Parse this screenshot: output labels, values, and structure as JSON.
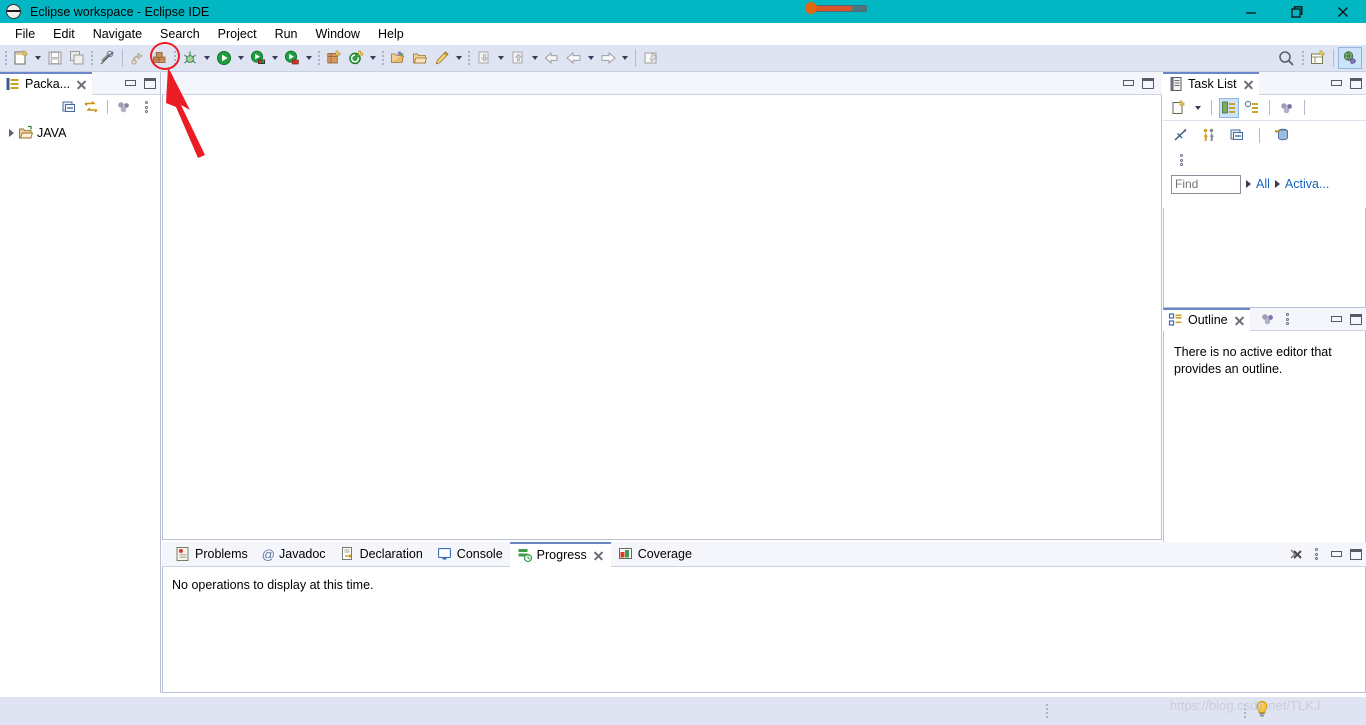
{
  "window": {
    "title": "Eclipse workspace - Eclipse IDE",
    "icon": "eclipse-globe-icon",
    "titlebar_color": "#00b7c3",
    "controls": {
      "minimize": "minimize-button",
      "restore": "restore-button",
      "close": "close-button"
    }
  },
  "menubar": {
    "items": [
      {
        "label": "File"
      },
      {
        "label": "Edit"
      },
      {
        "label": "Navigate"
      },
      {
        "label": "Search"
      },
      {
        "label": "Project"
      },
      {
        "label": "Run"
      },
      {
        "label": "Window"
      },
      {
        "label": "Help"
      }
    ]
  },
  "toolbar": {
    "background": "#dfe4f3",
    "groups": [
      {
        "buttons": [
          {
            "name": "new-wizard-icon",
            "tooltip": "New",
            "dropdown": true,
            "enabled": true
          },
          {
            "name": "save-icon",
            "tooltip": "Save",
            "enabled": false
          },
          {
            "name": "save-all-icon",
            "tooltip": "Save All",
            "enabled": false
          }
        ]
      },
      {
        "buttons": [
          {
            "name": "toggle-mark-occurrences-icon",
            "tooltip": "Toggle Mark Occurrences",
            "enabled": false
          }
        ]
      },
      {
        "buttons": [
          {
            "name": "build-all-icon",
            "tooltip": "Build All",
            "enabled": false
          },
          {
            "name": "new-java-package-icon",
            "tooltip": "New Java Package",
            "enabled": true,
            "highlighted": true
          }
        ]
      },
      {
        "buttons": [
          {
            "name": "debug-icon",
            "tooltip": "Debug",
            "dropdown": true,
            "enabled": true
          },
          {
            "name": "run-icon",
            "tooltip": "Run",
            "dropdown": true,
            "enabled": true
          },
          {
            "name": "coverage-icon",
            "tooltip": "Coverage",
            "dropdown": true,
            "enabled": true
          },
          {
            "name": "run-external-tools-icon",
            "tooltip": "External Tools",
            "dropdown": true,
            "enabled": true
          }
        ]
      },
      {
        "buttons": [
          {
            "name": "new-java-project-icon",
            "tooltip": "New Java Project",
            "enabled": true
          },
          {
            "name": "new-java-class-icon",
            "tooltip": "New Java Class",
            "dropdown": true,
            "enabled": true
          }
        ]
      },
      {
        "buttons": [
          {
            "name": "open-type-icon",
            "tooltip": "Open Type",
            "enabled": true
          },
          {
            "name": "open-task-icon",
            "tooltip": "Open Task",
            "enabled": true
          },
          {
            "name": "edit-icon",
            "tooltip": "Edit",
            "dropdown": true,
            "enabled": true
          }
        ]
      },
      {
        "buttons": [
          {
            "name": "next-annotation-icon",
            "tooltip": "Next Annotation",
            "dropdown": true,
            "enabled": false
          },
          {
            "name": "previous-annotation-icon",
            "tooltip": "Previous Annotation",
            "dropdown": true,
            "enabled": false
          },
          {
            "name": "last-edit-location-icon",
            "tooltip": "Last Edit Location",
            "enabled": false
          },
          {
            "name": "back-icon",
            "tooltip": "Back",
            "dropdown": true,
            "enabled": false
          },
          {
            "name": "forward-icon",
            "tooltip": "Forward",
            "dropdown": true,
            "enabled": false
          }
        ]
      },
      {
        "buttons": [
          {
            "name": "pin-editor-icon",
            "tooltip": "Pin Editor",
            "enabled": false
          }
        ]
      }
    ],
    "right_buttons": [
      {
        "name": "search-icon",
        "tooltip": "Search"
      },
      {
        "name": "open-perspective-icon",
        "tooltip": "Open Perspective"
      },
      {
        "name": "java-ee-perspective-icon",
        "tooltip": "Java EE",
        "active": true
      }
    ]
  },
  "annotation": {
    "ellipse_target": "new-java-package-icon",
    "arrow": "red-arrow-pointer",
    "color": "#ec1c24"
  },
  "package_explorer": {
    "tab_label": "Packa...",
    "tab_icon": "package-explorer-icon",
    "toolbar": [
      {
        "name": "collapse-all-icon",
        "tooltip": "Collapse All"
      },
      {
        "name": "link-with-editor-icon",
        "tooltip": "Link with Editor"
      },
      {
        "name": "view-menu-icon",
        "tooltip": "View Menu"
      },
      {
        "name": "panel-menu-icon",
        "tooltip": "Menu"
      }
    ],
    "tree": [
      {
        "label": "JAVA",
        "icon": "java-project-folder-icon",
        "expanded": false
      }
    ]
  },
  "editor": {
    "empty": true,
    "buttons": [
      {
        "name": "minimize-editor-button"
      },
      {
        "name": "maximize-editor-button"
      }
    ]
  },
  "task_list": {
    "tab_label": "Task List",
    "tab_icon": "task-list-icon",
    "toolbar_row1": [
      {
        "name": "new-task-icon",
        "tooltip": "New Task",
        "dropdown": true
      },
      {
        "name": "categorized-presentation-icon",
        "tooltip": "Categorized",
        "active": true
      },
      {
        "name": "scheduled-presentation-icon",
        "tooltip": "Scheduled"
      },
      {
        "name": "view-menu-icon",
        "tooltip": "View Menu"
      }
    ],
    "toolbar_row2": [
      {
        "name": "focus-on-workweek-icon",
        "tooltip": "Focus on Workweek"
      },
      {
        "name": "synchronize-changed-icon",
        "tooltip": "Synchronize Changed"
      },
      {
        "name": "collapse-all-icon",
        "tooltip": "Collapse All"
      },
      {
        "name": "open-repository-task-icon",
        "tooltip": "Open Repository Task"
      }
    ],
    "toolbar_row3": [
      {
        "name": "panel-menu-icon",
        "tooltip": "Menu"
      }
    ],
    "find": {
      "placeholder": "Find",
      "value": ""
    },
    "filters": [
      {
        "label": "All"
      },
      {
        "label": "Activa..."
      }
    ]
  },
  "outline": {
    "tab_label": "Outline",
    "tab_icon": "outline-icon",
    "toolbar": [
      {
        "name": "view-menu-icon"
      },
      {
        "name": "panel-menu-icon"
      },
      {
        "name": "minimize-button"
      },
      {
        "name": "maximize-button"
      }
    ],
    "message": "There is no active editor that provides an outline."
  },
  "bottom_panel": {
    "tabs": [
      {
        "label": "Problems",
        "icon": "problems-icon",
        "active": false
      },
      {
        "label": "Javadoc",
        "icon": "javadoc-at-icon",
        "active": false
      },
      {
        "label": "Declaration",
        "icon": "declaration-icon",
        "active": false
      },
      {
        "label": "Console",
        "icon": "console-icon",
        "active": false
      },
      {
        "label": "Progress",
        "icon": "progress-icon",
        "active": true
      },
      {
        "label": "Coverage",
        "icon": "coverage-icon",
        "active": false
      }
    ],
    "toolbar": [
      {
        "name": "cancel-all-operations-icon"
      },
      {
        "name": "panel-menu-icon"
      },
      {
        "name": "minimize-button"
      },
      {
        "name": "maximize-button"
      }
    ],
    "content": "No operations to display at this time."
  },
  "statusbar": {
    "watermark": "https://blog.csdn.net/TLKJ",
    "tip_icon": "lightbulb-icon"
  }
}
